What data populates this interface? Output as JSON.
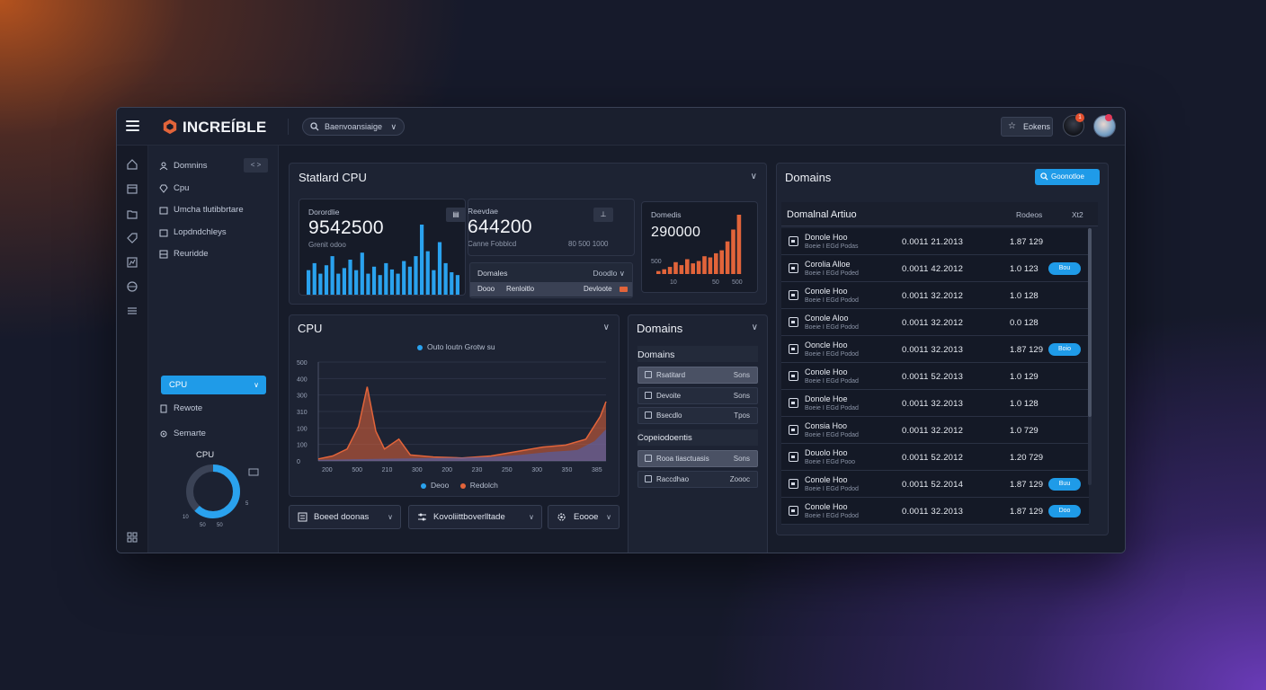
{
  "app": {
    "brand": "INCREÍBLE",
    "selector_label": "Baenvoansiaige",
    "top_button_label": "Eokens"
  },
  "colors": {
    "accent": "#1f9be8",
    "orange": "#e2643a",
    "panel": "#1d2333"
  },
  "sidebar": {
    "items": [
      {
        "label": "Domnins",
        "icon": "user-icon"
      },
      {
        "label": "Cpu",
        "icon": "gem-icon"
      },
      {
        "label": "Umcha tlutibbrtare",
        "icon": "calendar-icon"
      },
      {
        "label": "Lopdndchleys",
        "icon": "calendar-icon"
      },
      {
        "label": "Reuridde",
        "icon": "grid-icon"
      },
      {
        "label": "Rewote",
        "icon": "doc-icon"
      },
      {
        "label": "Semarte",
        "icon": "cog-icon"
      }
    ],
    "collapse_label": "<  >",
    "active_item": "CPU",
    "donut": {
      "title": "CPU",
      "value_fraction": 0.62,
      "labels": [
        "5",
        "50",
        "50"
      ],
      "axis_label": "5",
      "corner": "10"
    }
  },
  "cpu_panel": {
    "title": "Statlard CPU",
    "card1": {
      "label": "Dorordlie",
      "value": "9542500",
      "sub": "Grenit odoo",
      "button": "▤"
    },
    "card2": {
      "label": "Reevdae",
      "value": "644200",
      "sub": "Canne Fobblcd",
      "range": "80 500 1000",
      "button": "⊥"
    },
    "card3": {
      "label": "Domedis",
      "value": "290000",
      "axis": [
        "10",
        "50",
        "500"
      ],
      "axis_top": "500"
    },
    "mini_table": {
      "row1_left": "Domales",
      "row1_right": "Doodlo ∨",
      "row2_left": "Dooo",
      "row2_mid": "Renloitlo",
      "row2_right": "Devloote"
    }
  },
  "cpu_chart": {
    "title": "CPU",
    "legend_top": "Outo loutn Grotw su",
    "legend_bottom": [
      "Deoo",
      "Redolch"
    ],
    "y_ticks": [
      "500",
      "400",
      "300",
      "310",
      "100",
      "100",
      "0"
    ],
    "x_ticks": [
      "200",
      "500",
      "210",
      "300",
      "200",
      "230",
      "250",
      "300",
      "350",
      "385"
    ]
  },
  "domains_panel": {
    "title": "Domains",
    "section1": "Domains",
    "items1": [
      {
        "label": "Rsatitard",
        "right": "Sons",
        "selected": true
      },
      {
        "label": "Devoite",
        "right": "Sons",
        "selected": false
      },
      {
        "label": "Bsecdlo",
        "right": "Tpos",
        "selected": false
      }
    ],
    "section2": "Copeiodoentis",
    "items2": [
      {
        "label": "Rooa tiasctuasis",
        "right": "Sons",
        "selected": true
      },
      {
        "label": "Raccdhao",
        "right": "Zoooc",
        "selected": false
      }
    ]
  },
  "bottom_buttons": [
    {
      "label": "Boeed doonas",
      "icon": "settings-icon"
    },
    {
      "label": "Kovoliittboverlltade",
      "icon": "sliders-icon"
    },
    {
      "label": "Eoooe",
      "icon": "gear-icon"
    }
  ],
  "right_panel": {
    "title": "Domains",
    "action_button": "Goonotloe",
    "table_title": "Domalnal Artiuo",
    "col2": "Rodeos",
    "col3": "Xt2",
    "rows": [
      {
        "name": "Donole Hoo",
        "sub": "Boeie I EGd Podas",
        "value": "0.0011 21.2013",
        "value2": "1.87 129",
        "badge": ""
      },
      {
        "name": "Corolia Alloe",
        "sub": "Boeie I EGd Poded",
        "value": "0.0011 42.2012",
        "value2": "1.0 123",
        "badge": "Bou"
      },
      {
        "name": "Conole Hoo",
        "sub": "Boeie I EGd Podod",
        "value": "0.0011 32.2012",
        "value2": "1.0 128",
        "badge": ""
      },
      {
        "name": "Conole Aloo",
        "sub": "Boeie I EGd Podod",
        "value": "0.0011 32.2012",
        "value2": "0.0 128",
        "badge": ""
      },
      {
        "name": "Ooncle Hoo",
        "sub": "Boeie I EGd Podod",
        "value": "0.0011 32.2013",
        "value2": "1.87 129",
        "badge": "Boio"
      },
      {
        "name": "Conole Hoo",
        "sub": "Boeie I EGd Podad",
        "value": "0.0011 52.2013",
        "value2": "1.0 129",
        "badge": ""
      },
      {
        "name": "Donole Hoe",
        "sub": "Boeie I EGd Podad",
        "value": "0.0011 32.2013",
        "value2": "1.0 128",
        "badge": ""
      },
      {
        "name": "Consia Hoo",
        "sub": "Boeie I EGd Podad",
        "value": "0.0011 32.2012",
        "value2": "1.0 729",
        "badge": ""
      },
      {
        "name": "Douolo Hoo",
        "sub": "Boeie I EGd Pooo",
        "value": "0.0011 52.2012",
        "value2": "1.20 729",
        "badge": ""
      },
      {
        "name": "Conole Hoo",
        "sub": "Boeie I EGd Podod",
        "value": "0.0011 52.2014",
        "value2": "1.87 129",
        "badge": "Buu"
      },
      {
        "name": "Conole Hoo",
        "sub": "Boeie I EGd Podod",
        "value": "0.0011 32.2013",
        "value2": "1.87 129",
        "badge": "Doo"
      }
    ]
  }
}
